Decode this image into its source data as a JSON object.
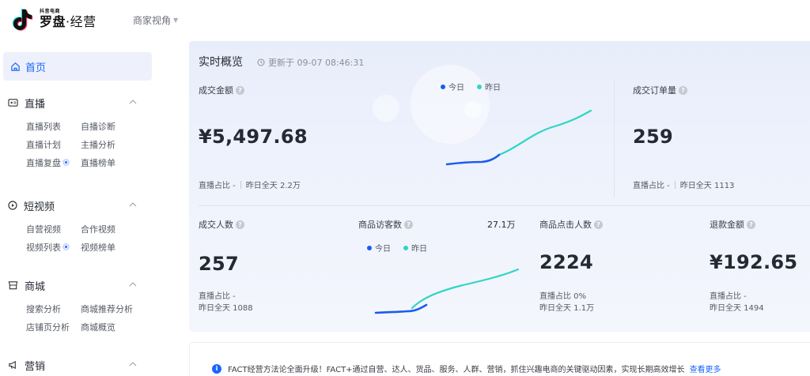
{
  "header": {
    "logo_small": "抖音电商",
    "logo_name_a": "罗盘",
    "logo_name_b": "·经营",
    "perspective": "商家视角"
  },
  "sidebar": {
    "home": "首页",
    "groups": [
      {
        "title": "直播",
        "rows": [
          [
            "直播列表",
            "自播诊断"
          ],
          [
            "直播计划",
            "主播分析"
          ],
          [
            "直播复盘",
            "直播榜单"
          ]
        ]
      },
      {
        "title": "短视频",
        "rows": [
          [
            "自营视频",
            "合作视频"
          ],
          [
            "视频列表",
            "视频榜单"
          ]
        ]
      },
      {
        "title": "商城",
        "rows": [
          [
            "搜索分析",
            "商城推荐分析"
          ],
          [
            "店铺页分析",
            "商城概览"
          ]
        ]
      },
      {
        "title": "营销",
        "rows": []
      }
    ]
  },
  "overview": {
    "title": "实时概览",
    "updated": "更新于 09-07 08:46:31",
    "legend_today": "今日",
    "legend_yesterday": "昨日",
    "cards": {
      "gmv": {
        "label": "成交金额",
        "value": "¥5,497.68",
        "sub_a": "直播占比 -",
        "sub_b": "昨日全天 2.2万"
      },
      "orders": {
        "label": "成交订单量",
        "value": "259",
        "sub_a": "直播占比 -",
        "sub_b": "昨日全天 1113"
      },
      "buyers": {
        "label": "成交人数",
        "value": "257",
        "sub_a": "直播占比 -",
        "sub_b": "昨日全天 1088"
      },
      "visitors": {
        "label": "商品访客数",
        "value": "27.1万"
      },
      "clicks": {
        "label": "商品点击人数",
        "value": "2224",
        "sub_a": "直播占比 0%",
        "sub_b": "昨日全天 1.1万"
      },
      "refund": {
        "label": "退款金额",
        "value": "¥192.65",
        "sub_a": "直播占比 -",
        "sub_b": "昨日全天 1494"
      }
    }
  },
  "notice": {
    "text": "FACT经营方法论全面升级！FACT+通过自营、达人、货品、服务、人群、营销，抓住兴趣电商的关键驱动因素，实现长期高效增长",
    "link": "查看更多"
  },
  "colors": {
    "accent": "#1966ff",
    "today": "#1a5cf0",
    "yesterday": "#2fd6c4"
  }
}
